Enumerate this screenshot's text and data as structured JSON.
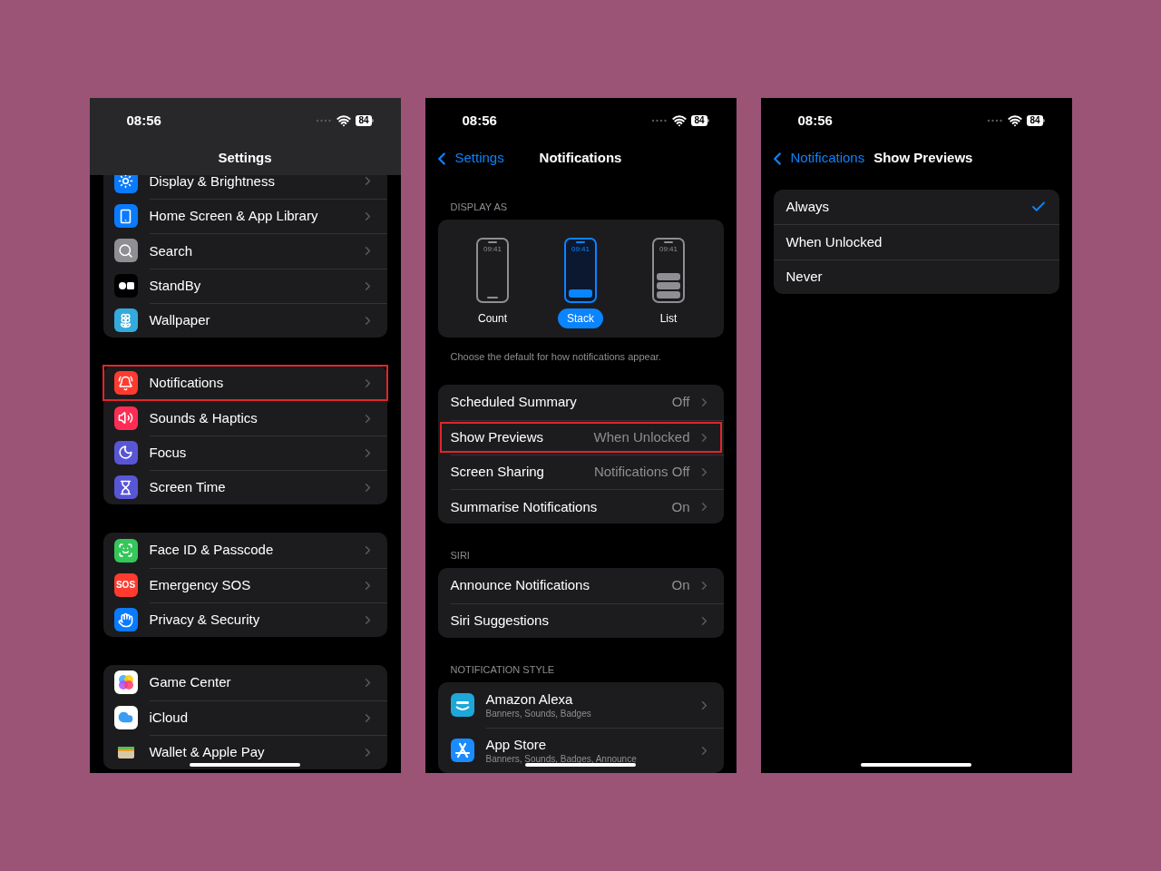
{
  "settings_screen": {
    "status_bar": {
      "time": "08:56",
      "battery": "84"
    },
    "title": "Settings",
    "groups": [
      {
        "items": [
          {
            "label": "Display & Brightness",
            "kind": "display",
            "highlighted": false
          },
          {
            "label": "Home Screen & App Library",
            "kind": "homescreen",
            "highlighted": false
          },
          {
            "label": "Search",
            "kind": "search",
            "highlighted": false
          },
          {
            "label": "StandBy",
            "kind": "standby",
            "highlighted": false
          },
          {
            "label": "Wallpaper",
            "kind": "wallpaper",
            "highlighted": false
          }
        ]
      },
      {
        "items": [
          {
            "label": "Notifications",
            "kind": "notifications",
            "highlighted": true
          },
          {
            "label": "Sounds & Haptics",
            "kind": "sounds",
            "highlighted": false
          },
          {
            "label": "Focus",
            "kind": "focus",
            "highlighted": false
          },
          {
            "label": "Screen Time",
            "kind": "screentime",
            "highlighted": false
          }
        ]
      },
      {
        "items": [
          {
            "label": "Face ID & Passcode",
            "kind": "faceid",
            "highlighted": false
          },
          {
            "label": "Emergency SOS",
            "kind": "sos",
            "icon_text": "SOS",
            "highlighted": false
          },
          {
            "label": "Privacy & Security",
            "kind": "privacy",
            "highlighted": false
          }
        ]
      },
      {
        "items": [
          {
            "label": "Game Center",
            "kind": "gamecenter",
            "highlighted": false
          },
          {
            "label": "iCloud",
            "kind": "icloud",
            "highlighted": false
          },
          {
            "label": "Wallet & Apple Pay",
            "kind": "wallet",
            "highlighted": false
          }
        ]
      }
    ]
  },
  "notifications_screen": {
    "status_bar": {
      "time": "08:56",
      "battery": "84"
    },
    "back": "Settings",
    "title": "Notifications",
    "display_as": {
      "header": "DISPLAY AS",
      "options": [
        {
          "label": "Count",
          "preview_time": "09:41",
          "kind": "count",
          "selected": false
        },
        {
          "label": "Stack",
          "preview_time": "09:41",
          "kind": "stack",
          "selected": true
        },
        {
          "label": "List",
          "preview_time": "09:41",
          "kind": "list",
          "selected": false
        }
      ],
      "footer": "Choose the default for how notifications appear."
    },
    "groups": [
      {
        "items": [
          {
            "label": "Scheduled Summary",
            "value": "Off",
            "highlighted": false
          },
          {
            "label": "Show Previews",
            "value": "When Unlocked",
            "highlighted": true
          },
          {
            "label": "Screen Sharing",
            "value": "Notifications Off",
            "highlighted": false
          },
          {
            "label": "Summarise Notifications",
            "value": "On",
            "highlighted": false
          }
        ]
      },
      {
        "header": "SIRI",
        "items": [
          {
            "label": "Announce Notifications",
            "value": "On",
            "highlighted": false
          },
          {
            "label": "Siri Suggestions",
            "highlighted": false
          }
        ]
      }
    ],
    "notification_style": {
      "header": "NOTIFICATION STYLE",
      "apps": [
        {
          "name": "Amazon Alexa",
          "subtitle": "Banners, Sounds, Badges",
          "kind": "alexa"
        },
        {
          "name": "App Store",
          "subtitle": "Banners, Sounds, Badges, Announce",
          "kind": "appstore"
        }
      ]
    }
  },
  "show_previews_screen": {
    "status_bar": {
      "time": "08:56",
      "battery": "84"
    },
    "back": "Notifications",
    "title": "Show Previews",
    "options": [
      {
        "label": "Always",
        "selected": true
      },
      {
        "label": "When Unlocked",
        "selected": false
      },
      {
        "label": "Never",
        "selected": false
      }
    ]
  }
}
